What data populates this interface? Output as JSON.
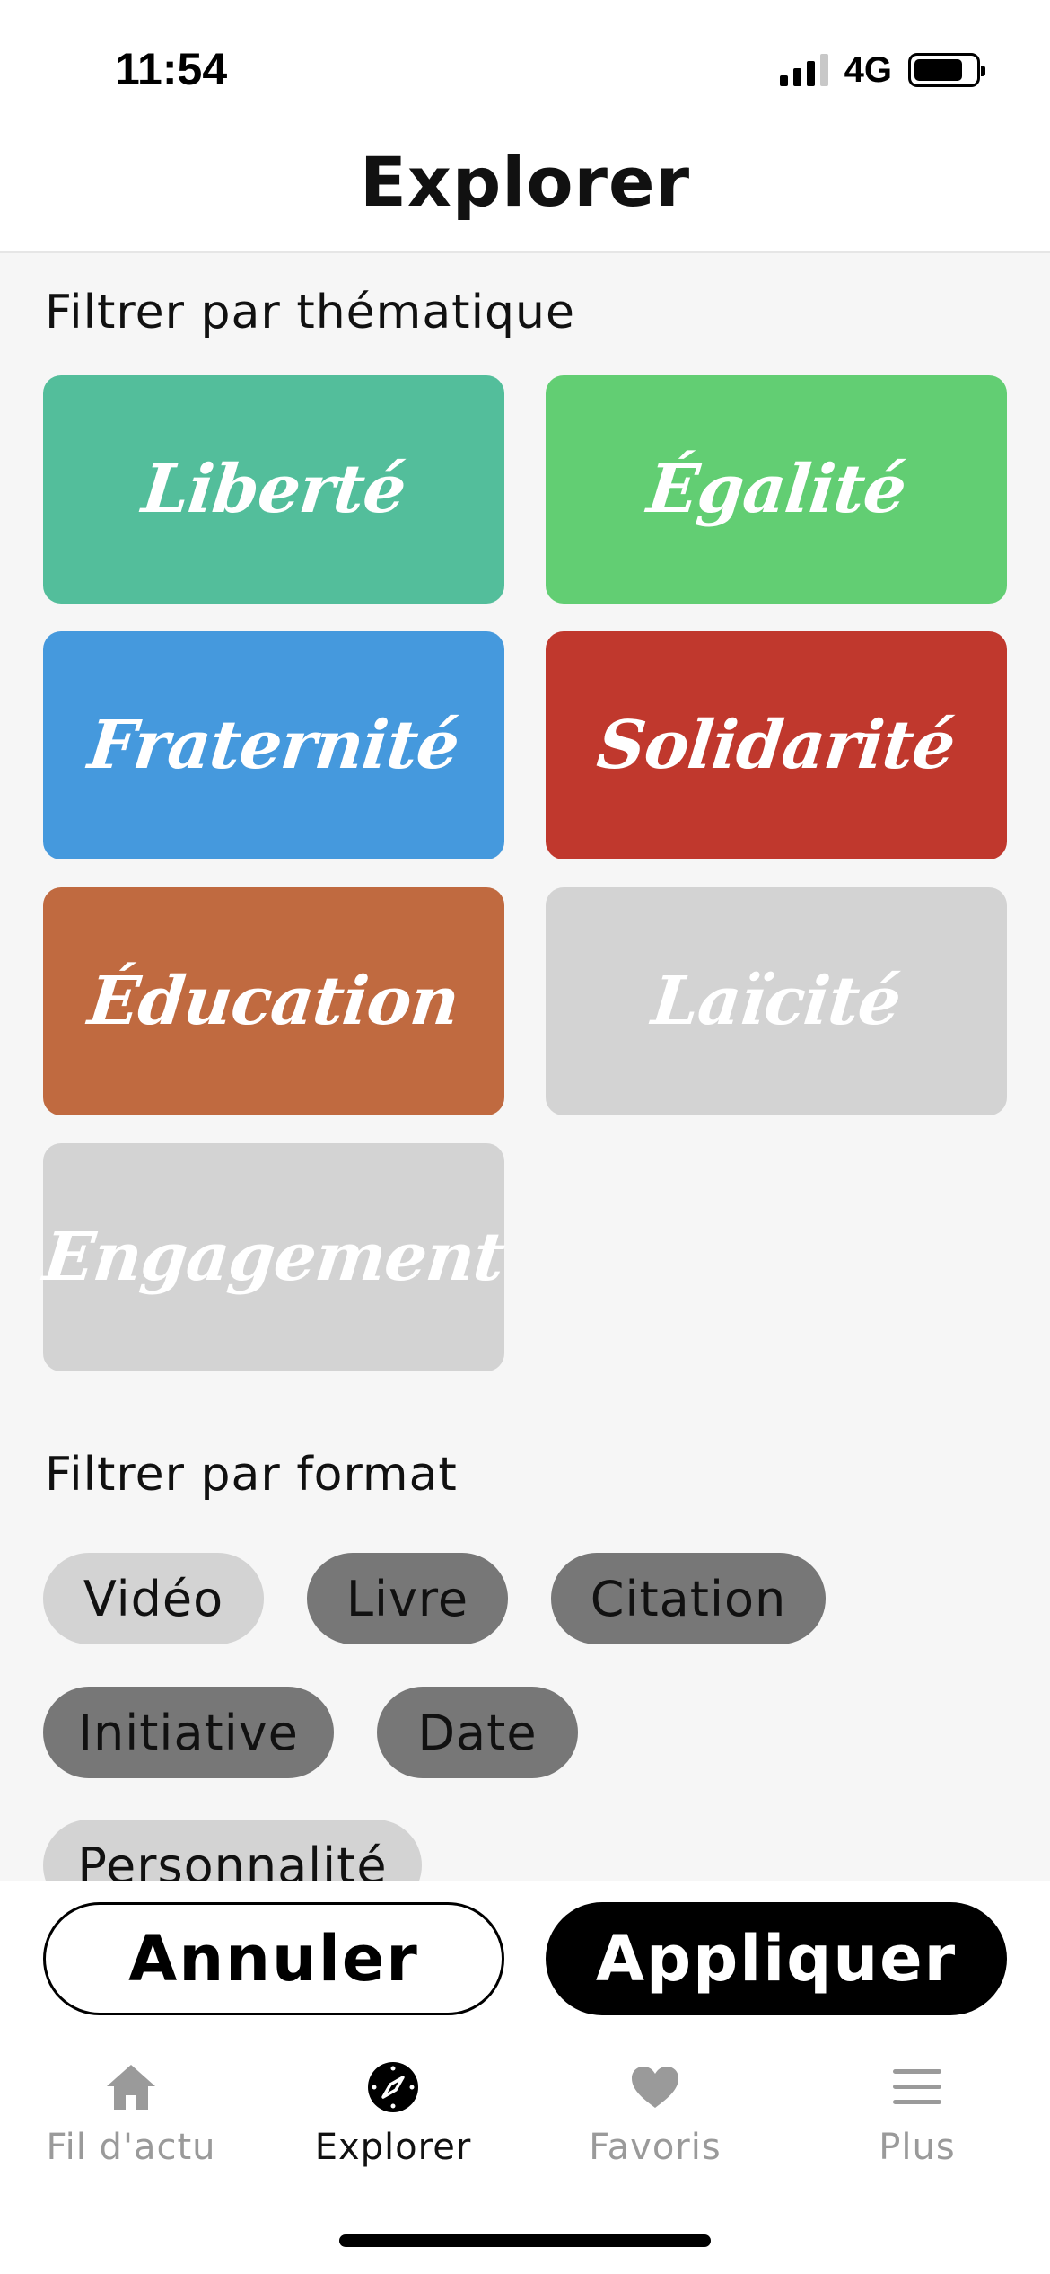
{
  "status_bar": {
    "time": "11:54",
    "network": "4G",
    "battery_level": 0.8
  },
  "header": {
    "title": "Explorer"
  },
  "themes": {
    "title": "Filtrer par thématique",
    "items": [
      {
        "label": "Liberté",
        "color": "#53BE9B"
      },
      {
        "label": "Égalité",
        "color": "#62CE73"
      },
      {
        "label": "Fraternité",
        "color": "#4599DD"
      },
      {
        "label": "Solidarité",
        "color": "#C0382D"
      },
      {
        "label": "Éducation",
        "color": "#C06A40"
      },
      {
        "label": "Laïcité",
        "color": "#D3D3D3"
      },
      {
        "label": "Engagement",
        "color": "#D3D3D3"
      }
    ]
  },
  "formats": {
    "title": "Filtrer par format",
    "items": [
      {
        "label": "Vidéo",
        "selected": false
      },
      {
        "label": "Livre",
        "selected": true
      },
      {
        "label": "Citation",
        "selected": true
      },
      {
        "label": "Initiative",
        "selected": true
      },
      {
        "label": "Date",
        "selected": true
      },
      {
        "label": "Personnalité",
        "selected": false
      }
    ]
  },
  "actions": {
    "cancel_label": "Annuler",
    "apply_label": "Appliquer"
  },
  "tabs": [
    {
      "label": "Fil d'actu",
      "icon": "home-icon",
      "active": false
    },
    {
      "label": "Explorer",
      "icon": "compass-icon",
      "active": true
    },
    {
      "label": "Favoris",
      "icon": "heart-icon",
      "active": false
    },
    {
      "label": "Plus",
      "icon": "menu-icon",
      "active": false
    }
  ],
  "colors": {
    "chip_selected": "#777777",
    "chip_unselected": "#D3D3D3",
    "accent": "#000000"
  }
}
